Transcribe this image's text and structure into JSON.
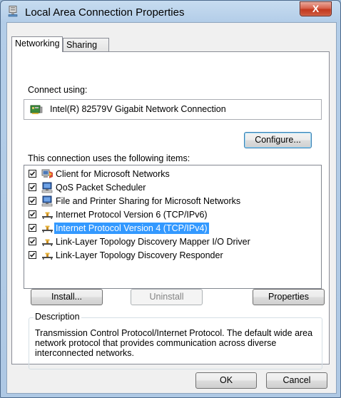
{
  "window": {
    "title": "Local Area Connection Properties",
    "close_label": "X"
  },
  "tabs": [
    {
      "label": "Networking",
      "active": true
    },
    {
      "label": "Sharing",
      "active": false
    }
  ],
  "connect_using": {
    "label": "Connect using:",
    "adapter": "Intel(R) 82579V Gigabit Network Connection",
    "configure_button": "Configure..."
  },
  "items_section": {
    "label": "This connection uses the following items:",
    "items": [
      {
        "label": "Client for Microsoft Networks",
        "checked": true,
        "icon": "network-client-icon"
      },
      {
        "label": "QoS Packet Scheduler",
        "checked": true,
        "icon": "network-service-icon"
      },
      {
        "label": "File and Printer Sharing for Microsoft Networks",
        "checked": true,
        "icon": "network-service-icon"
      },
      {
        "label": "Internet Protocol Version 6 (TCP/IPv6)",
        "checked": true,
        "icon": "protocol-icon"
      },
      {
        "label": "Internet Protocol Version 4 (TCP/IPv4)",
        "checked": true,
        "icon": "protocol-icon",
        "selected": true
      },
      {
        "label": "Link-Layer Topology Discovery Mapper I/O Driver",
        "checked": true,
        "icon": "protocol-icon"
      },
      {
        "label": "Link-Layer Topology Discovery Responder",
        "checked": true,
        "icon": "protocol-icon"
      }
    ]
  },
  "buttons": {
    "install": "Install...",
    "uninstall": "Uninstall",
    "properties": "Properties",
    "ok": "OK",
    "cancel": "Cancel"
  },
  "description": {
    "title": "Description",
    "text": "Transmission Control Protocol/Internet Protocol. The default wide area network protocol that provides communication across diverse interconnected networks."
  },
  "colors": {
    "selection": "#3399ff",
    "close_button": "#c7432a"
  }
}
